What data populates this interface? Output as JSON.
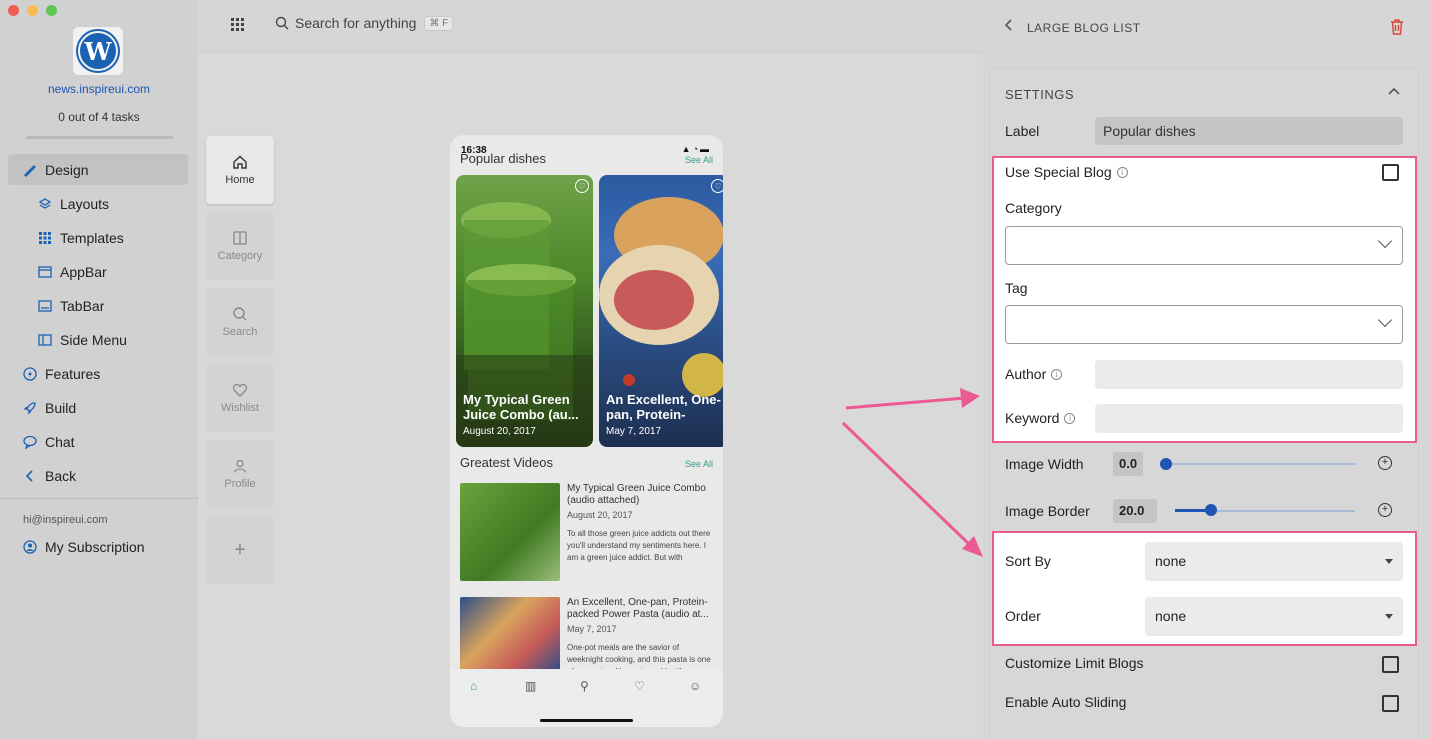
{
  "sidebar": {
    "site_url": "news.inspireui.com",
    "tasks": "0 out of 4 tasks",
    "items": [
      {
        "label": "Design",
        "icon": "brush-icon"
      },
      {
        "label": "Layouts",
        "icon": "layers-icon"
      },
      {
        "label": "Templates",
        "icon": "grid-icon"
      },
      {
        "label": "AppBar",
        "icon": "appbar-icon"
      },
      {
        "label": "TabBar",
        "icon": "tabbar-icon"
      },
      {
        "label": "Side Menu",
        "icon": "sidemenu-icon"
      },
      {
        "label": "Features",
        "icon": "bolt-icon"
      },
      {
        "label": "Build",
        "icon": "rocket-icon"
      },
      {
        "label": "Chat",
        "icon": "chat-icon"
      },
      {
        "label": "Back",
        "icon": "chevron-left-icon"
      }
    ],
    "email": "hi@inspireui.com",
    "subscription": "My Subscription"
  },
  "topbar": {
    "search_placeholder": "Search for anything",
    "shortcut": "⌘ F"
  },
  "tabs": [
    {
      "label": "Home",
      "icon": "home-icon"
    },
    {
      "label": "Category",
      "icon": "category-icon"
    },
    {
      "label": "Search",
      "icon": "search-icon"
    },
    {
      "label": "Wishlist",
      "icon": "heart-icon"
    },
    {
      "label": "Profile",
      "icon": "user-icon"
    }
  ],
  "phone": {
    "time": "16:38",
    "popular_title": "Popular dishes",
    "see_all": "See All",
    "cards": [
      {
        "title": "My Typical Green Juice Combo (au...",
        "date": "August 20, 2017"
      },
      {
        "title": "An Excellent, One-pan, Protein-pack...",
        "date": "May 7, 2017"
      }
    ],
    "videos_title": "Greatest Videos",
    "videos": [
      {
        "title": "My Typical Green Juice Combo (audio attached)",
        "date": "August 20, 2017",
        "desc": "To all those green juice addicts out there you'll understand my sentiments here. I am a green juice addict. But with"
      },
      {
        "title": "An Excellent, One-pan, Protein-packed Power Pasta (audio at...",
        "date": "May 7, 2017",
        "desc": "One-pot meals are the savior of weeknight cooking, and this pasta is one of my go-tos. It's pasta and lentils"
      }
    ]
  },
  "panel": {
    "title": "LARGE BLOG LIST",
    "settings_title": "SETTINGS",
    "label_label": "Label",
    "label_value": "Popular dishes",
    "use_special_blog": "Use Special Blog",
    "category": "Category",
    "tag": "Tag",
    "author": "Author",
    "keyword": "Keyword",
    "image_width": "Image Width",
    "image_width_value": "0.0",
    "image_border": "Image Border",
    "image_border_value": "20.0",
    "sort_by": "Sort By",
    "sort_by_value": "none",
    "order": "Order",
    "order_value": "none",
    "customize_limit": "Customize Limit Blogs",
    "auto_sliding": "Enable Auto Sliding"
  },
  "colors": {
    "accent": "#1b62b3",
    "highlight": "#ec5a93",
    "delete": "#d9453a",
    "link": "#3c9a8f"
  }
}
